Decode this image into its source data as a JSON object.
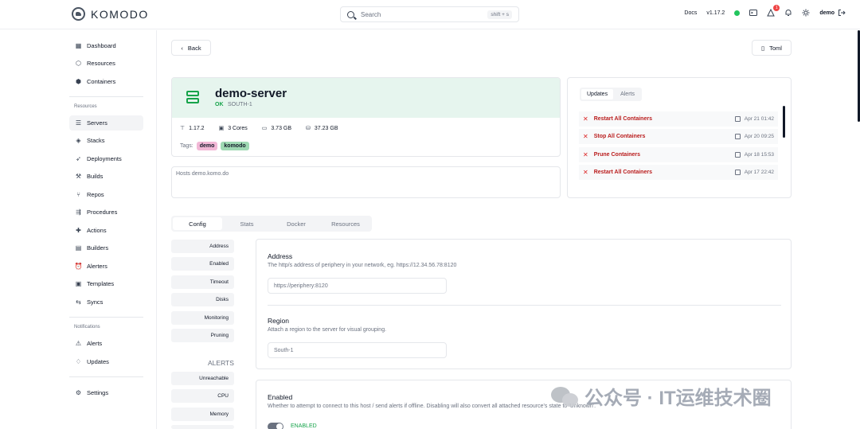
{
  "header": {
    "brand": "KOMODO",
    "search_placeholder": "Search",
    "search_shortcut": "shift + s",
    "docs_label": "Docs",
    "version": "v1.17.2",
    "notification_count": "1",
    "user": "demo"
  },
  "sidebar": {
    "items": [
      {
        "label": "Dashboard",
        "icon": "dashboard-icon"
      },
      {
        "label": "Resources",
        "icon": "boxes-icon"
      },
      {
        "label": "Containers",
        "icon": "container-icon"
      }
    ],
    "resources_title": "Resources",
    "resource_items": [
      {
        "label": "Servers",
        "icon": "server-icon"
      },
      {
        "label": "Stacks",
        "icon": "layers-icon"
      },
      {
        "label": "Deployments",
        "icon": "rocket-icon"
      },
      {
        "label": "Builds",
        "icon": "hammer-icon"
      },
      {
        "label": "Repos",
        "icon": "git-branch-icon"
      },
      {
        "label": "Procedures",
        "icon": "route-icon"
      },
      {
        "label": "Actions",
        "icon": "action-icon"
      },
      {
        "label": "Builders",
        "icon": "factory-icon"
      },
      {
        "label": "Alerters",
        "icon": "alarm-icon"
      },
      {
        "label": "Templates",
        "icon": "template-icon"
      },
      {
        "label": "Syncs",
        "icon": "sync-icon"
      }
    ],
    "notifications_title": "Notifications",
    "notification_items": [
      {
        "label": "Alerts",
        "icon": "alert-icon"
      },
      {
        "label": "Updates",
        "icon": "bell-icon"
      }
    ],
    "settings_label": "Settings"
  },
  "toolbar": {
    "back_label": "Back",
    "toml_label": "Toml"
  },
  "server": {
    "name": "demo-server",
    "status": "OK",
    "region": "SOUTH-1",
    "version": "1.17.2",
    "cores": "3 Cores",
    "memory": "3.73 GB",
    "disk": "37.23 GB",
    "tags_label": "Tags:",
    "tags": [
      {
        "label": "demo",
        "color": "#f2b8d6"
      },
      {
        "label": "komodo",
        "color": "#9fd9b3"
      }
    ],
    "description": "Hosts demo.komo.do"
  },
  "updates_panel": {
    "tabs": [
      "Updates",
      "Alerts"
    ],
    "rows": [
      {
        "title": "Restart All Containers",
        "date": "Apr 21 01:42"
      },
      {
        "title": "Stop All Containers",
        "date": "Apr 20 09:25"
      },
      {
        "title": "Prune Containers",
        "date": "Apr 18 15:53"
      },
      {
        "title": "Restart All Containers",
        "date": "Apr 17 22:42"
      }
    ]
  },
  "main_tabs": [
    "Config",
    "Stats",
    "Docker",
    "Resources"
  ],
  "config_nav": [
    "Address",
    "Enabled",
    "Timeout",
    "Disks",
    "Monitoring",
    "Pruning"
  ],
  "alerts_section": {
    "title": "ALERTS",
    "items": [
      "Unreachable",
      "CPU",
      "Memory"
    ]
  },
  "config": {
    "address": {
      "title": "Address",
      "desc": "The http/s address of periphery in your network, eg. https://12.34.56.78:8120",
      "placeholder": "https://periphery:8120"
    },
    "region": {
      "title": "Region",
      "desc": "Attach a region to the server for visual grouping.",
      "value": "South-1"
    },
    "enabled": {
      "title": "Enabled",
      "desc": "Whether to attempt to connect to this host / send alerts if offline. Disabling will also convert all attached resource's state to 'Unknown'.",
      "state_label": "ENABLED"
    }
  },
  "watermark": "公众号 · IT运维技术圈"
}
